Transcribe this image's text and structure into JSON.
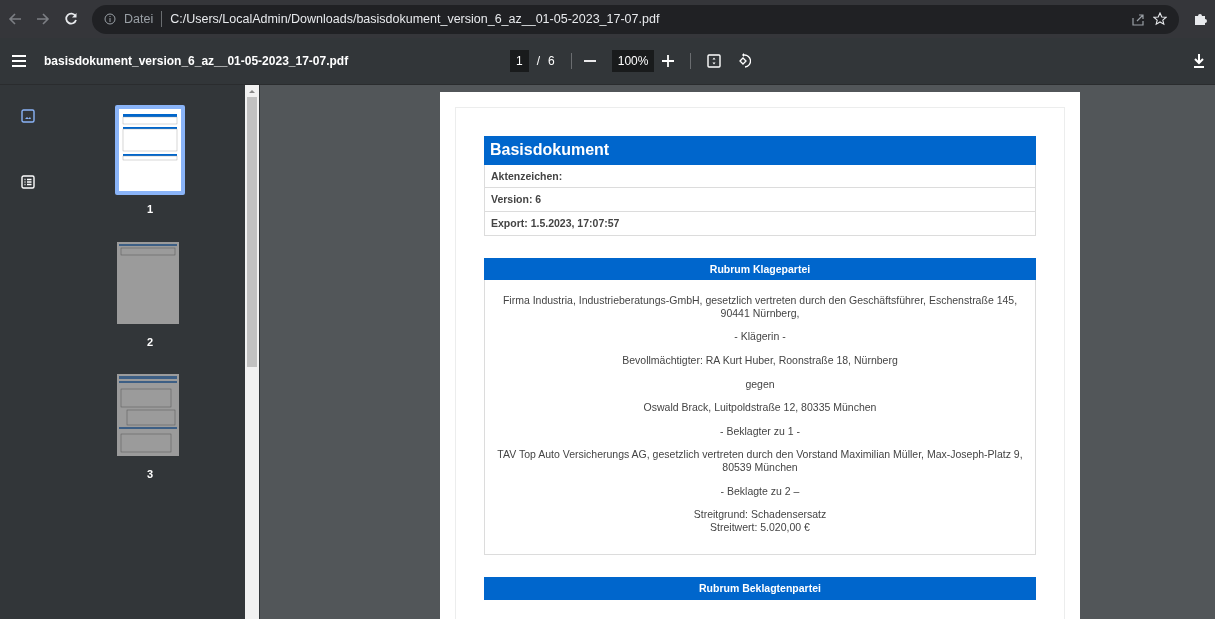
{
  "browser": {
    "address_prefix": "Datei",
    "url": "C:/Users/LocalAdmin/Downloads/basisdokument_version_6_az__01-05-2023_17-07.pdf"
  },
  "viewer": {
    "file_name": "basisdokument_version_6_az__01-05-2023_17-07.pdf",
    "page": "1",
    "separator": "/",
    "page_count": "6",
    "zoom": "100%"
  },
  "sidebar": {
    "tabs": [
      {
        "kind": "thumbnails",
        "selected": true
      },
      {
        "kind": "outline",
        "selected": false
      }
    ],
    "thumbnails": [
      {
        "label": "1",
        "kind": "cover",
        "selected": true
      },
      {
        "label": "2",
        "kind": "short",
        "selected": false
      },
      {
        "label": "3",
        "kind": "long",
        "selected": false
      }
    ]
  },
  "document": {
    "title": "Basisdokument",
    "fields": [
      "Aktenzeichen:",
      "Version: 6",
      "Export: 1.5.2023, 17:07:57"
    ],
    "sections": [
      {
        "heading": "Rubrum Klagepartei",
        "paragraphs": [
          [
            "Firma Industria, Industrieberatungs-GmbH, gesetzlich vertreten durch den Geschäftsführer, Eschenstraße 145, 90441 Nürnberg,"
          ],
          [
            "- Klägerin -"
          ],
          [
            "Bevollmächtigter: RA Kurt Huber, Roonstraße 18, Nürnberg"
          ],
          [
            "gegen"
          ],
          [
            "Oswald Brack, Luitpoldstraße 12, 80335 München"
          ],
          [
            "- Beklagter zu 1 -"
          ],
          [
            "TAV Top Auto Versicherungs AG, gesetzlich vertreten durch den Vorstand Maximilian Müller, Max-Joseph-Platz 9, 80539 München"
          ],
          [
            "- Beklagte zu 2 –"
          ],
          [
            "Streitgrund: Schadensersatz",
            "Streitwert: 5.020,00 €"
          ]
        ]
      },
      {
        "heading": "Rubrum Beklagtenpartei"
      }
    ]
  }
}
